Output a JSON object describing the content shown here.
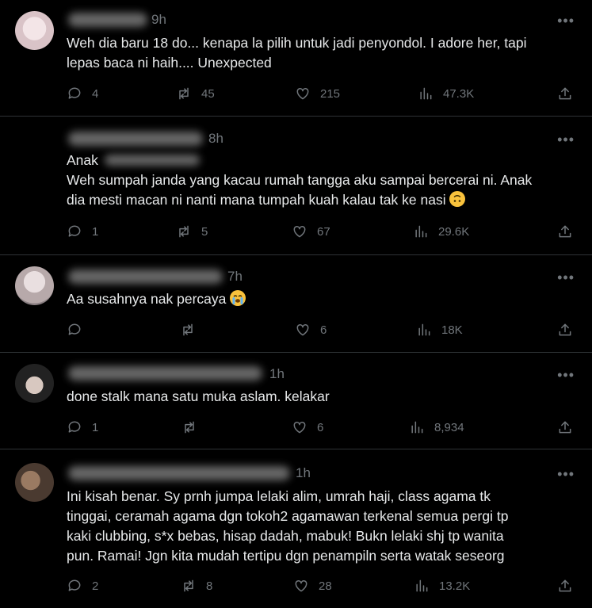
{
  "tweets": [
    {
      "time": "9h",
      "lines": [
        "Weh dia baru 18 do... kenapa la pilih untuk jadi penyondol. I adore her, tapi",
        "lepas baca ni haih.... Unexpected"
      ],
      "replies": "4",
      "reposts": "45",
      "likes": "215",
      "views": "47.3K"
    },
    {
      "time": "8h",
      "lines": [
        "Anak",
        "Weh sumpah janda yang kacau rumah tangga aku sampai bercerai ni. Anak",
        "dia mesti macan ni nanti mana tumpah kuah kalau tak ke nasi"
      ],
      "emoji": "upside-down-face",
      "replies": "1",
      "reposts": "5",
      "likes": "67",
      "views": "29.6K"
    },
    {
      "time": "7h",
      "lines": [
        "Aa susahnya nak percaya"
      ],
      "emoji": "loudly-crying-face",
      "replies": "",
      "reposts": "",
      "likes": "6",
      "views": "18K"
    },
    {
      "time": "1h",
      "lines": [
        "done stalk mana satu muka aslam. kelakar"
      ],
      "replies": "1",
      "reposts": "",
      "likes": "6",
      "views": "8,934"
    },
    {
      "time": "1h",
      "lines": [
        "Ini kisah benar. Sy prnh jumpa lelaki alim, umrah haji, class agama tk",
        "tinggai, ceramah agama dgn tokoh2 agamawan terkenal semua pergi tp",
        "kaki clubbing, s*x bebas, hisap dadah, mabuk! Bukn lelaki shj tp wanita",
        "pun. Ramai! Jgn kita mudah tertipu dgn penampiln serta watak seseorg"
      ],
      "replies": "2",
      "reposts": "8",
      "likes": "28",
      "views": "13.2K"
    }
  ],
  "more_label": "•••",
  "colors": {
    "background": "#000000",
    "text": "#e7e9ea",
    "muted": "#71767b",
    "divider": "#2f3336"
  },
  "icons": [
    "reply-icon",
    "repost-icon",
    "like-icon",
    "views-icon",
    "share-icon",
    "more-icon"
  ]
}
